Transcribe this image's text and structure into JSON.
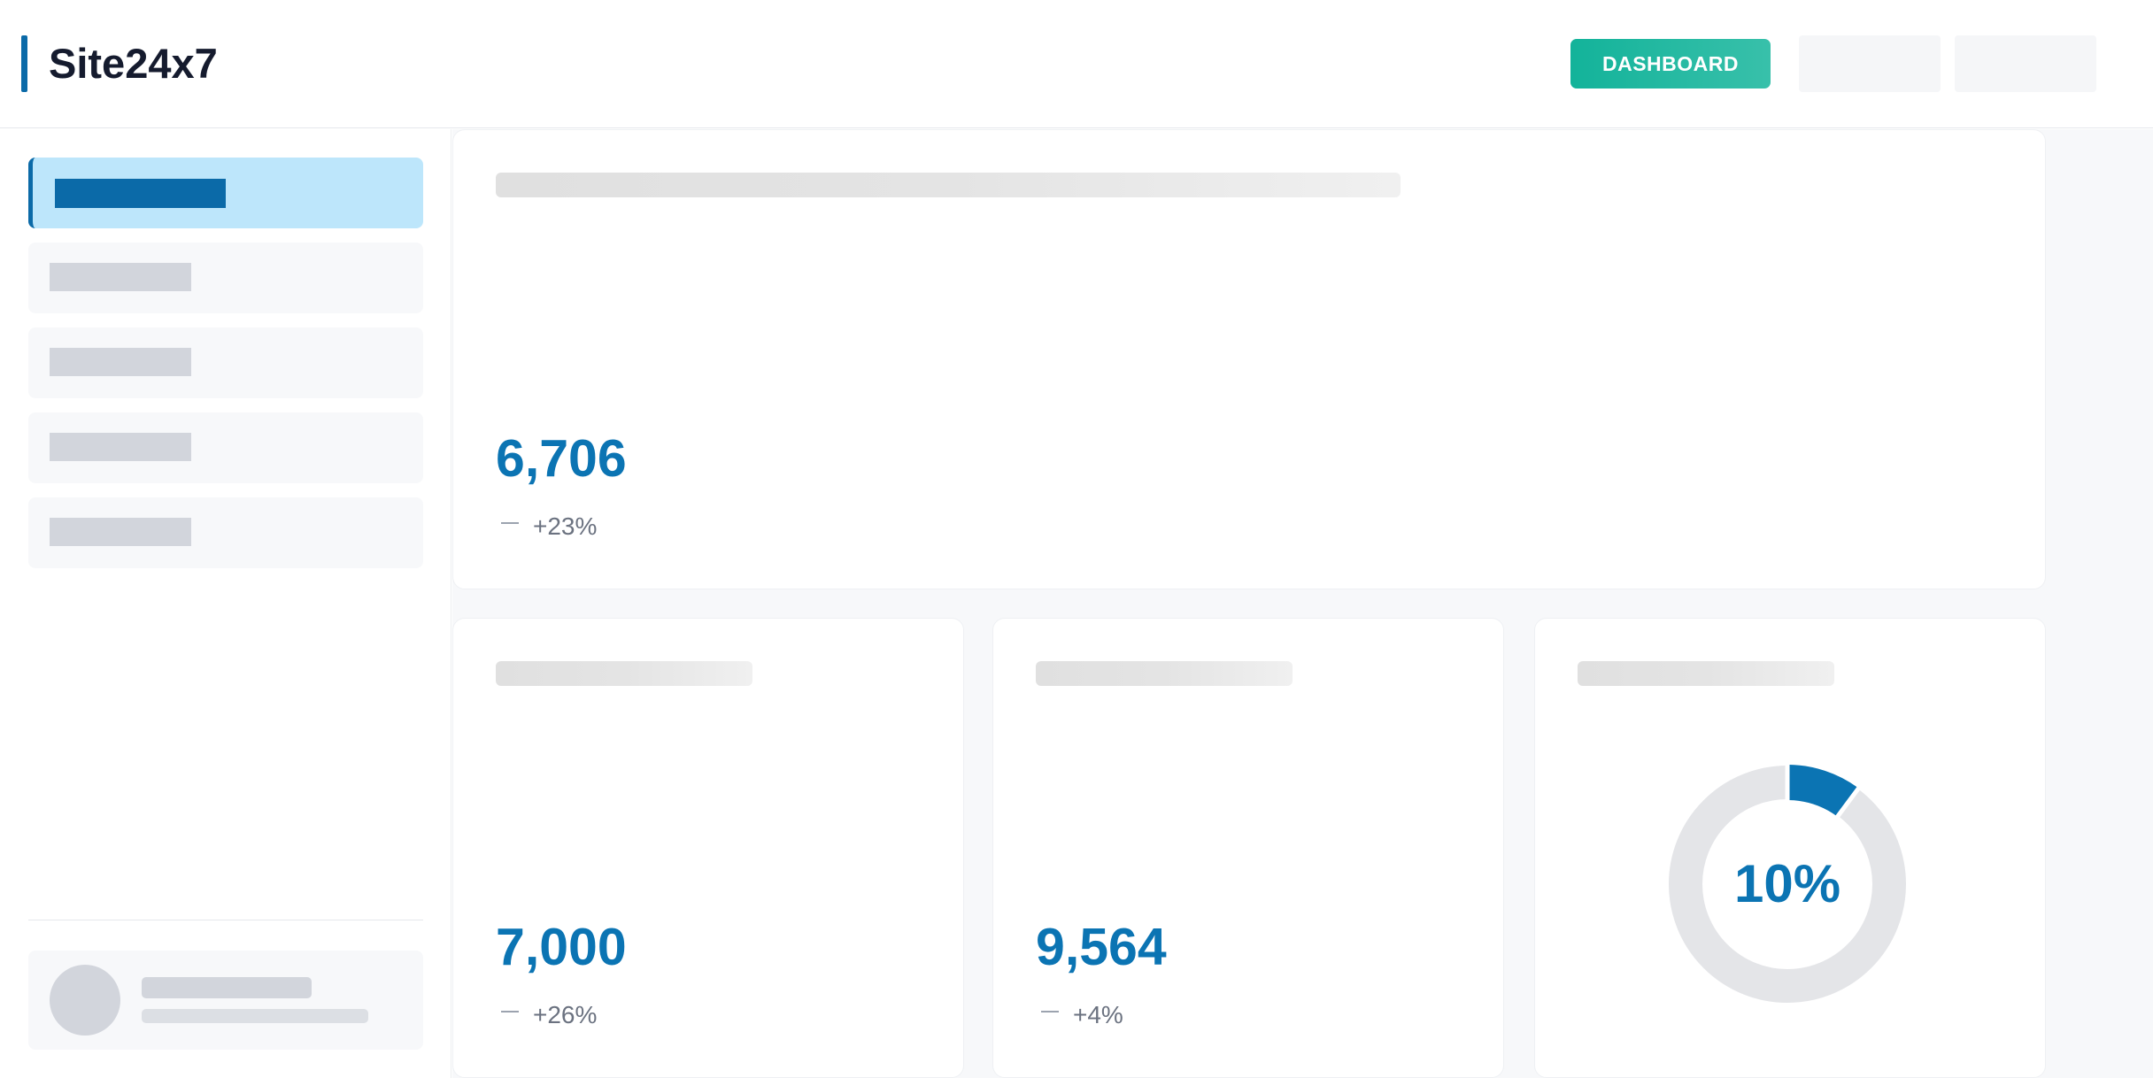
{
  "header": {
    "brand": "Site24x7",
    "dashboard_label": "DASHBOARD",
    "accent_color": "#13b39a",
    "brand_color": "#0b6aa8"
  },
  "sidebar": {
    "items": [
      {
        "state": "active"
      },
      {
        "state": "inactive"
      },
      {
        "state": "inactive"
      },
      {
        "state": "inactive"
      },
      {
        "state": "inactive"
      }
    ]
  },
  "cards": [
    {
      "value": "6,706",
      "trend": "+23%"
    },
    {
      "value": "7,000",
      "trend": "+26%"
    },
    {
      "value": "9,564",
      "trend": "+4%"
    }
  ],
  "donut": {
    "label": "10%",
    "percent": 10,
    "fill_color": "#0b74b3",
    "track_color": "#e4e5e8"
  }
}
